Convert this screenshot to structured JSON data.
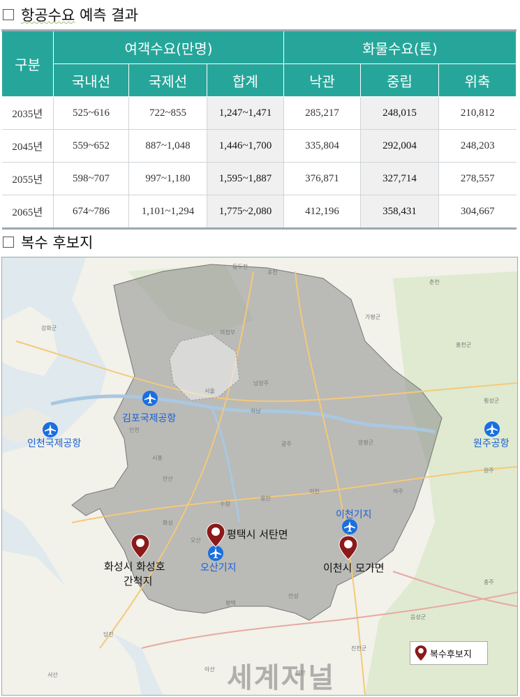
{
  "section1": {
    "title_a": "항공수요",
    "title_b": " 예측 결과"
  },
  "table": {
    "corner": "구분",
    "group_passenger": "여객수요(만명)",
    "group_cargo": "화물수요(톤)",
    "subheaders": [
      "국내선",
      "국제선",
      "합계",
      "낙관",
      "중립",
      "위축"
    ],
    "rows": [
      {
        "year": "2035년",
        "cells": [
          "525~616",
          "722~855",
          "1,247~1,471",
          "285,217",
          "248,015",
          "210,812"
        ]
      },
      {
        "year": "2045년",
        "cells": [
          "559~652",
          "887~1,048",
          "1,446~1,700",
          "335,804",
          "292,004",
          "248,203"
        ]
      },
      {
        "year": "2055년",
        "cells": [
          "598~707",
          "997~1,180",
          "1,595~1,887",
          "376,871",
          "327,714",
          "278,557"
        ]
      },
      {
        "year": "2065년",
        "cells": [
          "674~786",
          "1,101~1,294",
          "1,775~2,080",
          "412,196",
          "358,431",
          "304,667"
        ]
      }
    ]
  },
  "section2": {
    "title": "복수 후보지"
  },
  "map": {
    "airports": {
      "incheon": "인천국제공항",
      "gimpo": "김포국제공항",
      "osan": "오산기지",
      "icheon": "이천기지",
      "wonju": "원주공항"
    },
    "candidates": {
      "hwaseong_1": "화성시 화성호",
      "hwaseong_2": "간척지",
      "pyeongtaek": "평택시 서탄면",
      "icheon": "이천시 모가면"
    },
    "place_labels": [
      "서울",
      "인천",
      "강화군",
      "동두천",
      "포천",
      "가평군",
      "춘천",
      "홍천군",
      "횡성군",
      "원주",
      "양평군",
      "여주",
      "충주",
      "음성군",
      "진천군",
      "안성",
      "평택",
      "당진",
      "서산",
      "아산",
      "천안",
      "용인",
      "수원",
      "안산",
      "시흥",
      "의정부",
      "남양주",
      "하남",
      "광주",
      "이천",
      "화성",
      "오산"
    ],
    "legend": "복수후보지",
    "watermark": "세계저널"
  },
  "colors": {
    "teal": "#26a69a",
    "highlight": "#f0f0f0",
    "marker": "#8b1a1a",
    "airport_blue": "#1a5fd6",
    "shade": "#8c8c8c"
  }
}
